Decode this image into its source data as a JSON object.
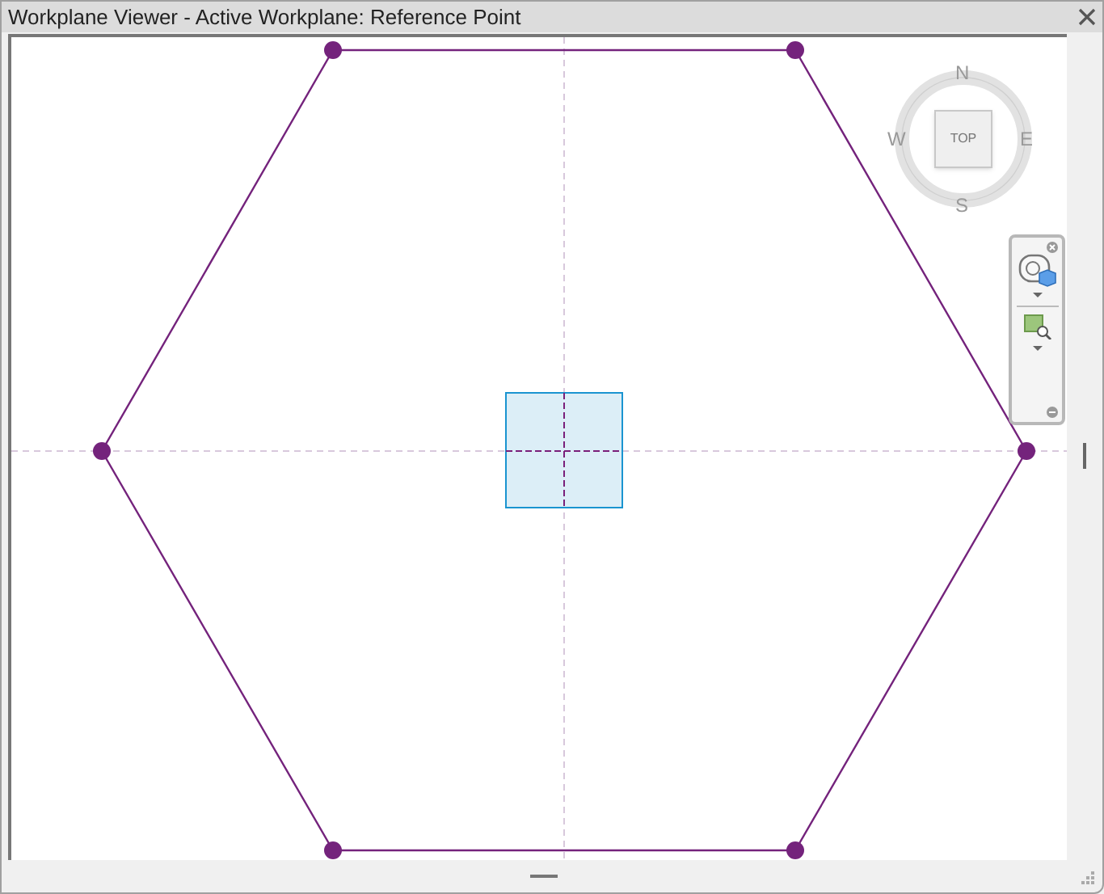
{
  "window": {
    "title": "Workplane Viewer - Active Workplane: Reference Point"
  },
  "viewcube": {
    "face": "TOP",
    "north": "N",
    "east": "E",
    "south": "S",
    "west": "W"
  }
}
